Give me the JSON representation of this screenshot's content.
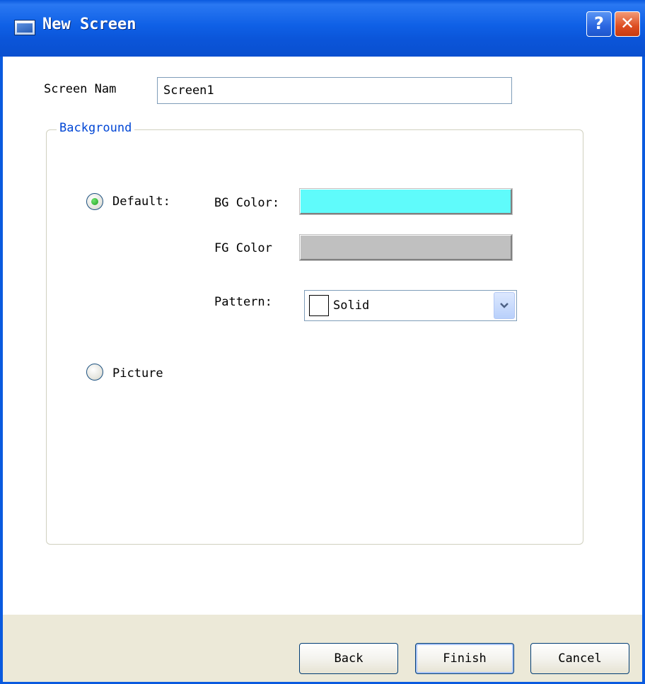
{
  "window": {
    "title": "New Screen",
    "help_glyph": "?",
    "close_glyph": "✕",
    "title_icon": "window-app-icon"
  },
  "form": {
    "screen_name_label": "Screen Nam",
    "screen_name_value": "Screen1"
  },
  "background_group": {
    "legend": "Background",
    "default_option": {
      "label": "Default:",
      "selected": true
    },
    "picture_option": {
      "label": "Picture",
      "selected": false
    },
    "bg_color_label": "BG Color:",
    "bg_color_value": "#5ffbfb",
    "fg_color_label": "FG Color",
    "fg_color_value": "#c0c0c0",
    "pattern_label": "Pattern:",
    "pattern_value": "Solid"
  },
  "footer": {
    "back_label": "Back",
    "finish_label": "Finish",
    "cancel_label": "Cancel"
  },
  "colors": {
    "title_bar": "#0b55d9",
    "accent_legend": "#0046d5",
    "footer_bg": "#ece9d8"
  }
}
